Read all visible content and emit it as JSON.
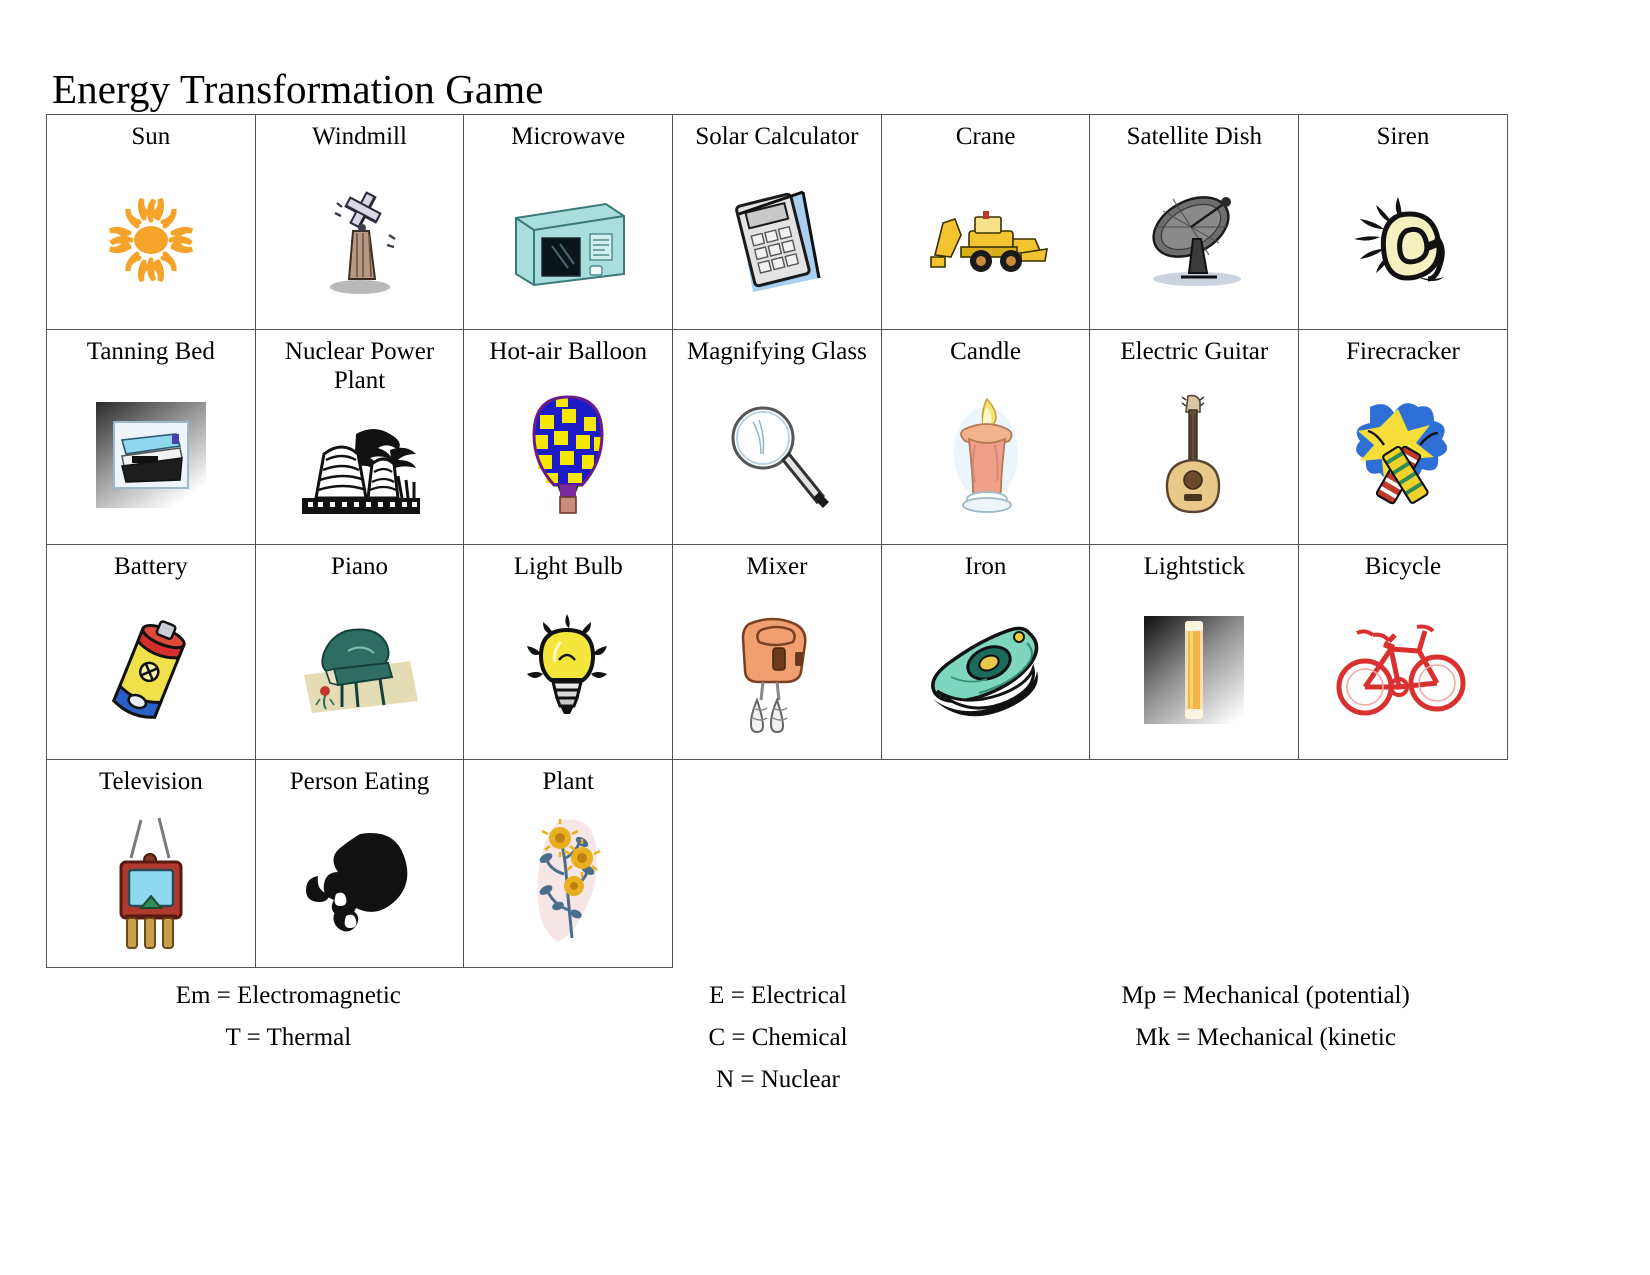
{
  "page": {
    "title": "Energy Transformation Game"
  },
  "table": {
    "columns": 7,
    "rows": [
      [
        {
          "label": "Sun",
          "icon": "sun-icon"
        },
        {
          "label": "Windmill",
          "icon": "windmill-icon"
        },
        {
          "label": "Microwave",
          "icon": "microwave-icon"
        },
        {
          "label": "Solar Calculator",
          "icon": "solar-calculator-icon"
        },
        {
          "label": "Crane",
          "icon": "crane-icon"
        },
        {
          "label": "Satellite Dish",
          "icon": "satellite-dish-icon"
        },
        {
          "label": "Siren",
          "icon": "siren-icon"
        }
      ],
      [
        {
          "label": "Tanning Bed",
          "icon": "tanning-bed-icon"
        },
        {
          "label": "Nuclear Power Plant",
          "icon": "nuclear-power-plant-icon"
        },
        {
          "label": "Hot-air Balloon",
          "icon": "hot-air-balloon-icon"
        },
        {
          "label": "Magnifying Glass",
          "icon": "magnifying-glass-icon"
        },
        {
          "label": "Candle",
          "icon": "candle-icon"
        },
        {
          "label": "Electric Guitar",
          "icon": "electric-guitar-icon"
        },
        {
          "label": "Firecracker",
          "icon": "firecracker-icon"
        }
      ],
      [
        {
          "label": "Battery",
          "icon": "battery-icon"
        },
        {
          "label": "Piano",
          "icon": "piano-icon"
        },
        {
          "label": "Light Bulb",
          "icon": "light-bulb-icon"
        },
        {
          "label": "Mixer",
          "icon": "mixer-icon"
        },
        {
          "label": "Iron",
          "icon": "iron-icon"
        },
        {
          "label": "Lightstick",
          "icon": "lightstick-icon"
        },
        {
          "label": "Bicycle",
          "icon": "bicycle-icon"
        }
      ],
      [
        {
          "label": "Television",
          "icon": "television-icon"
        },
        {
          "label": "Person Eating",
          "icon": "person-eating-icon"
        },
        {
          "label": "Plant",
          "icon": "plant-icon"
        }
      ]
    ]
  },
  "legend": {
    "columns": [
      {
        "lines": [
          "Em = Electromagnetic",
          "T = Thermal"
        ]
      },
      {
        "lines": [
          "E = Electrical",
          "C = Chemical",
          "N = Nuclear"
        ]
      },
      {
        "lines": [
          "Mp = Mechanical (potential)",
          "Mk = Mechanical (kinetic"
        ]
      }
    ]
  },
  "colors": {
    "border": "#555555",
    "background": "#ffffff",
    "text": "#000000",
    "sun": "#F5A32A",
    "microwave": "#A8DEDC",
    "calculator_paper": "#A8CFEF",
    "crane": "#F2C530",
    "balloon_blue": "#1B1BC8",
    "balloon_yellow": "#F5E800",
    "candle": "#F2B48C",
    "guitar": "#E8C98A",
    "battery_yellow": "#F0E14A",
    "battery_red": "#D32F2F",
    "piano": "#2E6E62",
    "bulb": "#F5E63C",
    "mixer": "#F0A070",
    "iron": "#7FD6BE",
    "lightstick": "#F5B544",
    "bicycle": "#D93030",
    "television": "#B03A2E",
    "plant_flower": "#E8B020"
  }
}
